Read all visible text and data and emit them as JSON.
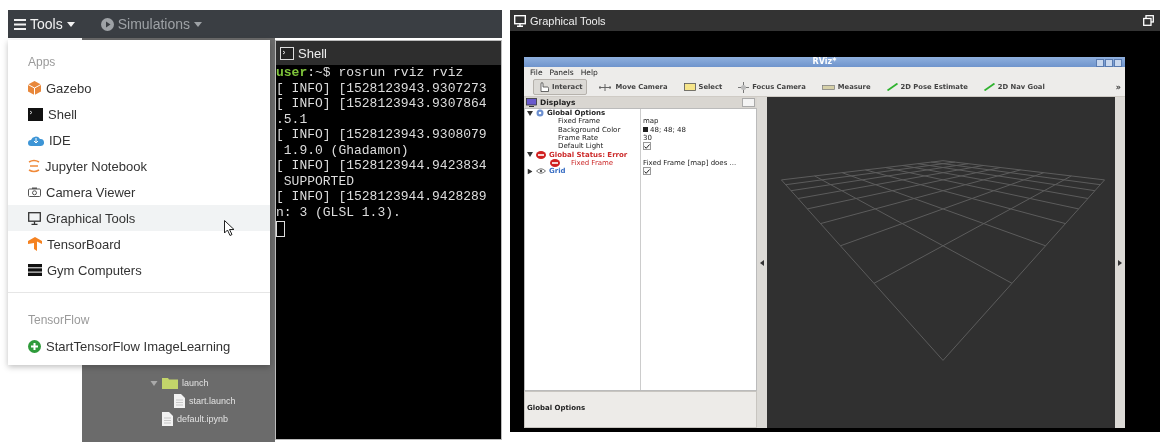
{
  "topbar": {
    "menus": [
      {
        "label": "Tools",
        "selected": true
      },
      {
        "label": "Simulations",
        "selected": false
      }
    ]
  },
  "tools_menu": {
    "sections": [
      {
        "header": "Apps",
        "items": [
          {
            "label": "Gazebo",
            "selected": false
          },
          {
            "label": "Shell",
            "selected": false
          },
          {
            "label": "IDE",
            "selected": false
          },
          {
            "label": "Jupyter Notebook",
            "selected": false
          },
          {
            "label": "Camera Viewer",
            "selected": false
          },
          {
            "label": "Graphical Tools",
            "selected": true
          },
          {
            "label": "TensorBoard",
            "selected": false
          },
          {
            "label": "Gym Computers",
            "selected": false
          }
        ]
      },
      {
        "header": "TensorFlow",
        "items": [
          {
            "label": "StartTensorFlow ImageLearning",
            "selected": false
          }
        ]
      }
    ]
  },
  "file_tree": [
    {
      "label": "launch",
      "expanded": true,
      "children": [
        {
          "label": "start.launch"
        }
      ]
    },
    {
      "label": "default.ipynb"
    }
  ],
  "shell": {
    "title": "Shell",
    "lines": [
      {
        "kind": "prompt",
        "user": "user",
        "command": ":~$ rosrun rviz rviz"
      },
      {
        "kind": "output",
        "text": "[ INFO] [1528123943.9307273"
      },
      {
        "kind": "output",
        "text": "[ INFO] [1528123943.9307864"
      },
      {
        "kind": "output",
        "text": ".5.1"
      },
      {
        "kind": "output",
        "text": "[ INFO] [1528123943.9308079"
      },
      {
        "kind": "output",
        "text": " 1.9.0 (Ghadamon)"
      },
      {
        "kind": "output",
        "text": "[ INFO] [1528123944.9423834"
      },
      {
        "kind": "output",
        "text": " SUPPORTED"
      },
      {
        "kind": "output",
        "text": "[ INFO] [1528123944.9428289"
      },
      {
        "kind": "output",
        "text": "n: 3 (GLSL 1.3)."
      }
    ]
  },
  "graphical_tools": {
    "title": "Graphical Tools",
    "rviz": {
      "title": "RViz*",
      "menu": [
        "File",
        "Panels",
        "Help"
      ],
      "tools": [
        {
          "label": "Interact",
          "selected": true
        },
        {
          "label": "Move Camera",
          "selected": false
        },
        {
          "label": "Select",
          "selected": false
        },
        {
          "label": "Focus Camera",
          "selected": false
        },
        {
          "label": "Measure",
          "selected": false
        },
        {
          "label": "2D Pose Estimate",
          "selected": false
        },
        {
          "label": "2D Nav Goal",
          "selected": false
        }
      ],
      "overflow": "»",
      "displays": {
        "title": "Displays",
        "tree": [
          {
            "label": "Global Options",
            "kind": "options",
            "expanded": true,
            "children": [
              {
                "label": "Fixed Frame",
                "kind": "text",
                "value": "map"
              },
              {
                "label": "Background Color",
                "kind": "color",
                "value": "48; 48; 48"
              },
              {
                "label": "Frame Rate",
                "kind": "text",
                "value": "30"
              },
              {
                "label": "Default Light",
                "kind": "checkbox",
                "checked": true
              }
            ]
          },
          {
            "label": "Global Status: Error",
            "kind": "status",
            "expanded": true,
            "children": [
              {
                "label": "Fixed Frame",
                "kind": "status",
                "value": "Fixed Frame [map] does ..."
              }
            ]
          },
          {
            "label": "Grid",
            "kind": "display",
            "expanded": false,
            "checked": true
          }
        ]
      },
      "description": {
        "title": "Global Options"
      }
    }
  }
}
